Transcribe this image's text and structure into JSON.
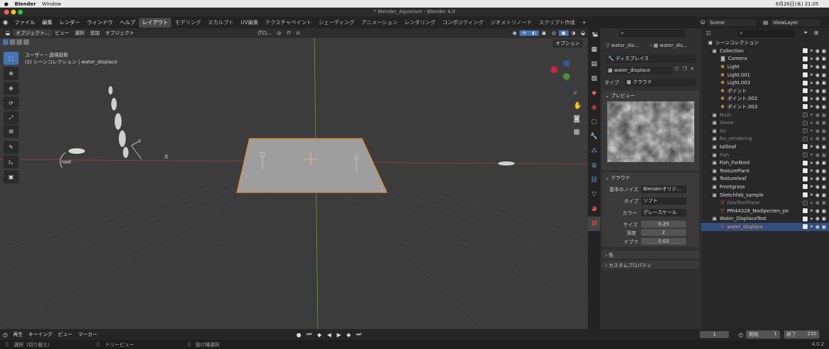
{
  "mac": {
    "app": "Blender",
    "menu_window": "Window",
    "clock": "6月26日(水) 21:05"
  },
  "window_title": "* Blender_Aquarium - Blender 4.0",
  "menus": [
    "ファイル",
    "編集",
    "レンダー",
    "ウィンドウ",
    "ヘルプ"
  ],
  "workspaces": [
    "レイアウト",
    "モデリング",
    "スカルプト",
    "UV編集",
    "テクスチャペイント",
    "シェーディング",
    "アニメーション",
    "レンダリング",
    "コンポジティング",
    "ジオメトリノード",
    "スクリプト作成"
  ],
  "scene": "Scene",
  "view_layer": "ViewLayer",
  "viewport": {
    "mode": "オブジェクト...",
    "view": "ビュー",
    "select": "選択",
    "add": "追加",
    "object": "オブジェクト",
    "orientation": "グロ...",
    "options": "オプション",
    "info_line1": "ユーザー・透視投影",
    "info_line2": "(1) シーンコレクション | water_displace",
    "root_label": "root",
    "axis_x": "X",
    "axis_y": "Y"
  },
  "properties": {
    "breadcrumb1": "water_dis...",
    "breadcrumb2": "water_dis...",
    "texture_type_dd": "ディスプレイス",
    "texture_name": "water_displace",
    "type_label": "タイプ",
    "type_value": "クラウド",
    "preview_header": "プレビュー",
    "clouds_header": "クラウド",
    "noise_basis_label": "基本のノイズ",
    "noise_basis_value": "Blenderオリジ...",
    "type2_label": "タイプ",
    "type2_value": "ソフト",
    "color_label": "カラー",
    "color_value": "グレースケール",
    "size_label": "サイズ",
    "size_value": "0.25",
    "depth_label": "深度",
    "depth_value": "2",
    "nabla_label": "ナブラ",
    "nabla_value": "0.03",
    "color_section": "色",
    "custom_props": "カスタムプロパティ"
  },
  "outliner": {
    "root": "シーンコレクション",
    "rows": [
      {
        "name": "Collection",
        "dim": false,
        "sel": false
      },
      {
        "name": "Camera",
        "dim": false,
        "sel": false
      },
      {
        "name": "Light",
        "dim": false,
        "sel": false
      },
      {
        "name": "Light.001",
        "dim": false,
        "sel": false
      },
      {
        "name": "Light.003",
        "dim": false,
        "sel": false
      },
      {
        "name": "ポイント",
        "dim": false,
        "sel": false
      },
      {
        "name": "ポイント.002",
        "dim": false,
        "sel": false
      },
      {
        "name": "ポイント.003",
        "dim": false,
        "sel": false
      },
      {
        "name": "Main",
        "dim": true,
        "sel": false
      },
      {
        "name": "Stone",
        "dim": true,
        "sel": false
      },
      {
        "name": "Air",
        "dim": true,
        "sel": false
      },
      {
        "name": "No_rendering",
        "dim": true,
        "sel": false
      },
      {
        "name": "tallleaf",
        "dim": false,
        "sel": false
      },
      {
        "name": "Fish",
        "dim": true,
        "sel": false
      },
      {
        "name": "Fish_ForBoid",
        "dim": false,
        "sel": false
      },
      {
        "name": "TexturePlant",
        "dim": false,
        "sel": false
      },
      {
        "name": "Textureleaf",
        "dim": false,
        "sel": false
      },
      {
        "name": "Frontgrass",
        "dim": false,
        "sel": false
      },
      {
        "name": "Sketchfab_sample",
        "dim": false,
        "sel": false
      },
      {
        "name": "GeoTestPlane",
        "dim": true,
        "sel": false
      },
      {
        "name": "PRI44328_Nodipecten_pe",
        "dim": false,
        "sel": false
      },
      {
        "name": "Water_DisplaceTest",
        "dim": false,
        "sel": false
      },
      {
        "name": "water_displace",
        "dim": false,
        "sel": true
      }
    ]
  },
  "timeline": {
    "playback": "再生",
    "keying": "キーイング",
    "view": "ビュー",
    "marker": "マーカー",
    "current_frame": "1",
    "start_label": "開始",
    "start": "1",
    "end_label": "終了",
    "end": "250"
  },
  "status": {
    "select": "選択（切り替え）",
    "dolly": "ドリービュー",
    "lasso": "投げ縄選択",
    "version": "4.0.2"
  },
  "colors": {
    "accent": "#4772b3",
    "select_orange": "#f0892a",
    "bg_viewport": "#3c3c3c"
  }
}
